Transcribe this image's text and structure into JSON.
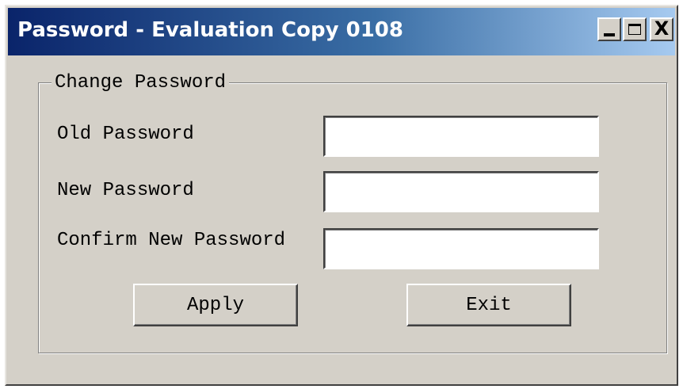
{
  "window": {
    "title": "Password - Evaluation Copy 0108",
    "controls": {
      "minimize_icon": "minimize-icon",
      "maximize_icon": "maximize-icon",
      "close_label": "X"
    }
  },
  "group": {
    "legend": "Change Password"
  },
  "fields": {
    "old_password": {
      "label": "Old Password",
      "value": ""
    },
    "new_password": {
      "label": "New Password",
      "value": ""
    },
    "confirm_password": {
      "label": "Confirm New Password",
      "value": ""
    }
  },
  "buttons": {
    "apply_label": "Apply",
    "exit_label": "Exit"
  },
  "colors": {
    "title_gradient_start": "#0a246a",
    "title_gradient_end": "#a6caf0",
    "dialog_face": "#d4d0c8"
  }
}
